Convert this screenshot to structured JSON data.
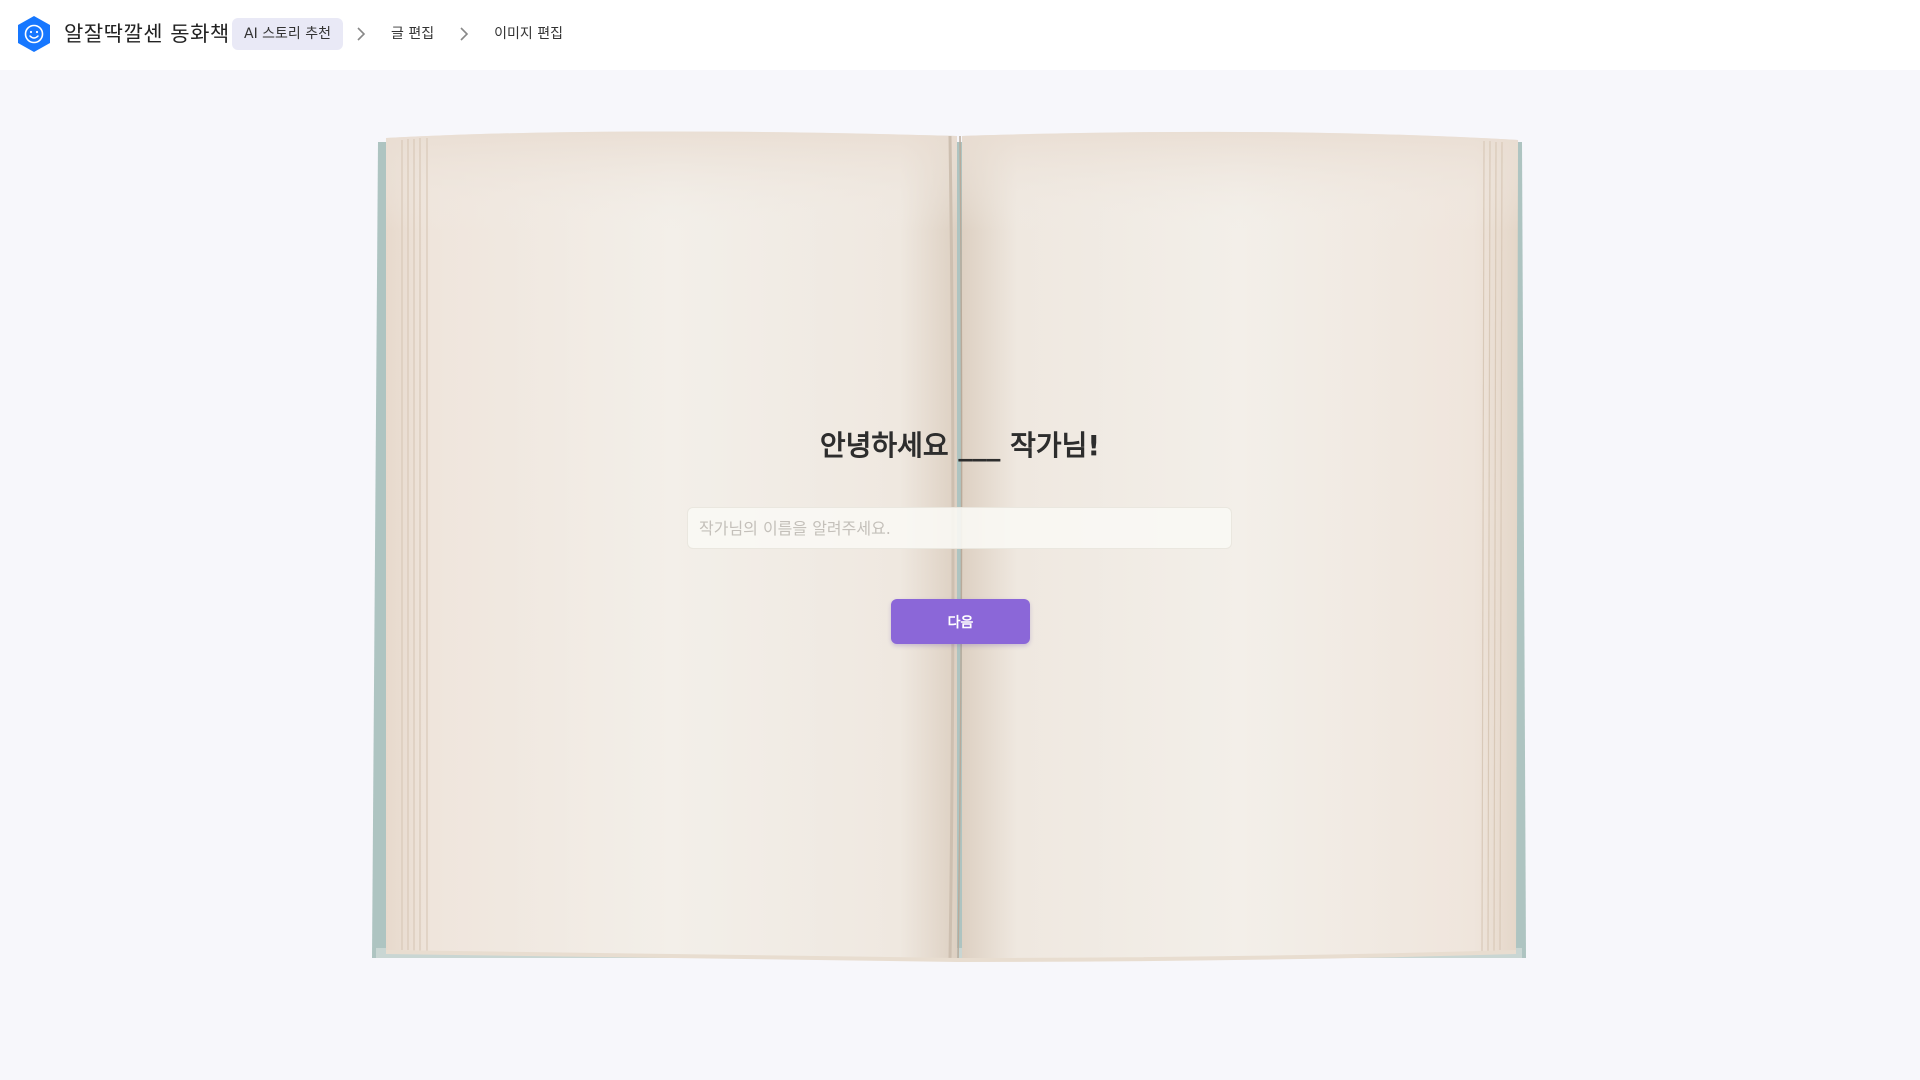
{
  "app": {
    "name": "알잘딱깔센 동화책",
    "logo_icon": "smiley-hexagon-icon",
    "brand_color": "#1677ff"
  },
  "breadcrumb": {
    "steps": [
      {
        "label": "AI 스토리 추천",
        "active": true
      },
      {
        "label": "글 편집",
        "active": false
      },
      {
        "label": "이미지 편집",
        "active": false
      }
    ],
    "separator_icon": "chevron-right-icon"
  },
  "main": {
    "greeting": "안녕하세요 ___ 작가님!",
    "name_field": {
      "value": "",
      "placeholder": "작가님의 이름을 알려주세요."
    },
    "next_button": "다음",
    "accent_color": "#8b67d8",
    "background_image": "open-book-illustration"
  }
}
